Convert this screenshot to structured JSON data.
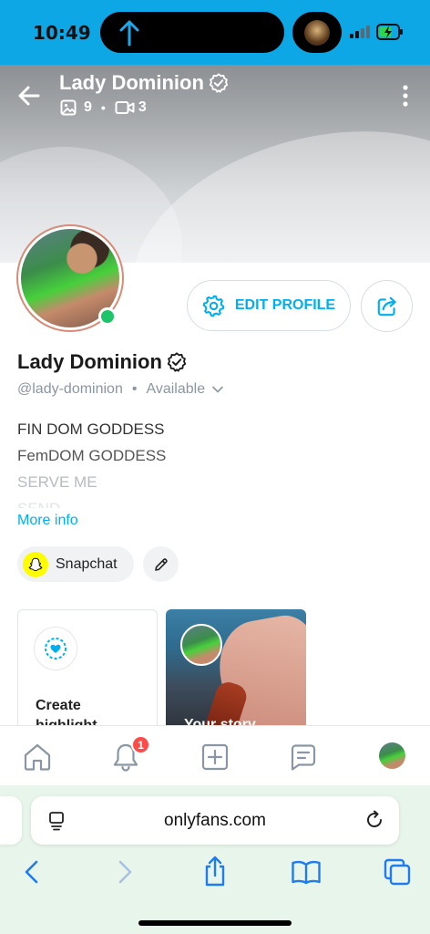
{
  "status": {
    "time": "10:49"
  },
  "header": {
    "name": "Lady Dominion",
    "photos_count": "9",
    "videos_count": "3"
  },
  "profile": {
    "edit_label": "EDIT PROFILE",
    "name": "Lady Dominion",
    "handle": "@lady-dominion",
    "availability": "Available",
    "bio": [
      "FIN DOM GODDESS",
      "FemDOM GODDESS",
      "SERVE ME",
      "SEND"
    ],
    "more_info": "More info",
    "snapchat_label": "Snapchat"
  },
  "highlights": {
    "create_label": "Create highlight",
    "story_label": "Your story"
  },
  "nav": {
    "notifications_badge": "1"
  },
  "browser": {
    "url": "onlyfans.com"
  },
  "colors": {
    "accent": "#00aff0",
    "status_bar": "#0da7e6",
    "online": "#1ec46a",
    "badge": "#ff4a4a",
    "snapchat": "#fffc00"
  },
  "icons": [
    "back-arrow-icon",
    "verified-icon",
    "image-icon",
    "video-icon",
    "more-vertical-icon",
    "gear-icon",
    "share-icon",
    "chevron-down-icon",
    "snapchat-icon",
    "pencil-icon",
    "heart-icon",
    "home-icon",
    "bell-icon",
    "plus-square-icon",
    "message-icon",
    "page-icon",
    "reload-icon",
    "safari-back-icon",
    "safari-forward-icon",
    "safari-share-icon",
    "bookmarks-icon",
    "tabs-icon"
  ]
}
